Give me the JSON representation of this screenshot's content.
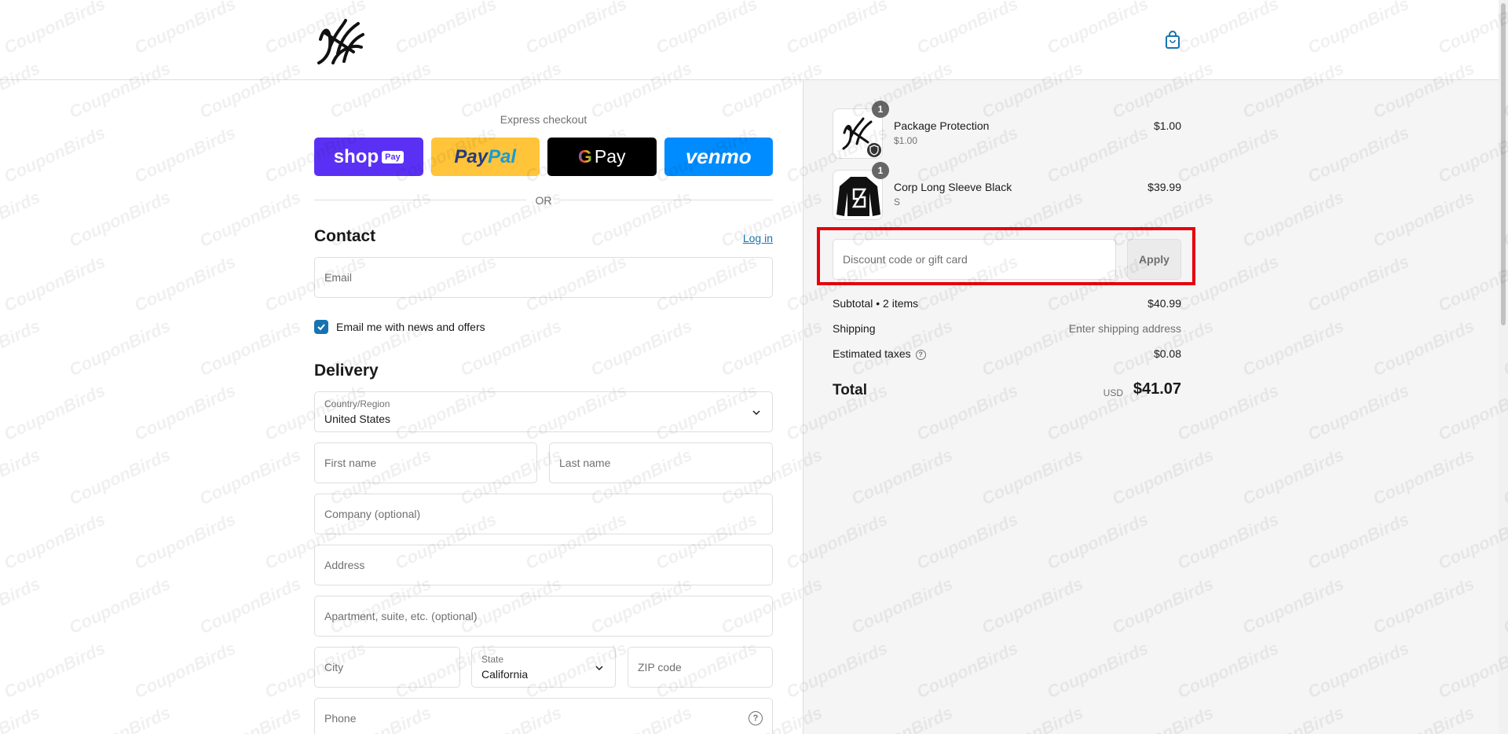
{
  "header": {
    "logo_icon": "brand-calligraphy-logo",
    "cart_icon": "shopping-bag-icon"
  },
  "express": {
    "label": "Express checkout",
    "buttons": {
      "shop_text": "shop",
      "shop_pill": "Pay",
      "paypal_a": "Pay",
      "paypal_b": "Pal",
      "gpay_g": "G",
      "gpay_text": "Pay",
      "venmo": "venmo"
    },
    "or": "OR"
  },
  "contact": {
    "title": "Contact",
    "login": "Log in",
    "email_placeholder": "Email",
    "newsletter_label": "Email me with news and offers",
    "newsletter_checked": true
  },
  "delivery": {
    "title": "Delivery",
    "country_label": "Country/Region",
    "country_value": "United States",
    "first_name": "First name",
    "last_name": "Last name",
    "company": "Company (optional)",
    "address": "Address",
    "apartment": "Apartment, suite, etc. (optional)",
    "city": "City",
    "state_label": "State",
    "state_value": "California",
    "zip": "ZIP code",
    "phone": "Phone"
  },
  "order": {
    "items": [
      {
        "name": "Package Protection",
        "sub": "$1.00",
        "price": "$1.00",
        "qty": "1",
        "thumb_icon": "brand-logo-shield-icon"
      },
      {
        "name": "Corp Long Sleeve Black",
        "sub": "S",
        "price": "$39.99",
        "qty": "1",
        "thumb_icon": "long-sleeve-shirt-icon"
      }
    ],
    "discount_placeholder": "Discount code or gift card",
    "apply": "Apply",
    "subtotal_label": "Subtotal • 2 items",
    "subtotal_value": "$40.99",
    "shipping_label": "Shipping",
    "shipping_value": "Enter shipping address",
    "taxes_label": "Estimated taxes",
    "taxes_value": "$0.08",
    "total_label": "Total",
    "total_currency": "USD",
    "total_value": "$41.07"
  },
  "watermark_text": "CouponBirds",
  "colors": {
    "accent": "#1773b0",
    "highlight": "#e8000b",
    "shop_pay": "#5a31f4",
    "paypal": "#ffc439",
    "venmo": "#008cff",
    "summary_bg": "#f5f5f5"
  }
}
